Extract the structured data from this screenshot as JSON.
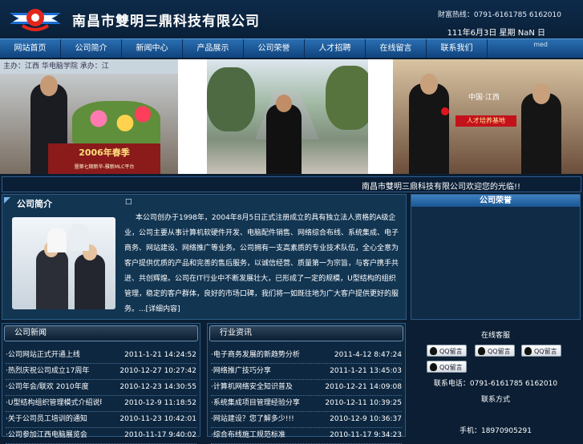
{
  "header": {
    "company_name": "南昌市雙明三鼎科技有限公司",
    "hotline": "财富热线：0791-6161785 6162010",
    "date": "111年6月3日 星期 NaN 日"
  },
  "nav": {
    "items": [
      "网站首页",
      "公司简介",
      "新闻中心",
      "产品展示",
      "公司荣誉",
      "人才招聘",
      "在线留言",
      "联系我们"
    ],
    "tail": "med"
  },
  "banner": {
    "photo1_caption": "2006年春季",
    "photo1_sub": "暨第七期新华-雅新MLC平台",
    "photo1_top": "主办：江西   华电脑学院    承办：江",
    "photo3_caption": "中国·江西",
    "photo3_sub": "人才培养基地"
  },
  "marquee": "南昌市雙明三鼎科技有限公司欢迎您的光临!!",
  "intro": {
    "title": "公司简介",
    "marker": "□",
    "text": "本公司创办于1998年，2004年8月5日正式注册成立的具有独立法人资格的A级企业，公司主要从事计算机软硬件开发、电脑配件销售、网络综合布线、系统集成、电子商务、网站建设、网络推广等业务。公司拥有一支高素质的专业技术队伍，全心全意为客户提供优质的产品和完善的售后服务，以诚信经营、质量第一为宗旨，与客户携手共进、共创辉煌。公司在IT行业中不断发展壮大，已形成了一定的规模，U型结构的组织管理，稳定的客户群体，良好的市场口碑，我们将一如既往地为广大客户提供更好的服务。...[详细内容]"
  },
  "right_panel": {
    "title": "公司荣誉"
  },
  "news_left": {
    "title": "公司新闻",
    "rows": [
      {
        "title": "·公司网站正式开通上线",
        "date": "2011-1-21 14:24:52"
      },
      {
        "title": "·热烈庆祝公司成立17周年",
        "date": "2010-12-27 10:27:42"
      },
      {
        "title": "·公司年会/联欢 2010年度",
        "date": "2010-12-23 14:30:55"
      },
      {
        "title": "·U型结构组织管理模式介绍说明",
        "date": "2010-12-9 11:18:52"
      },
      {
        "title": "·关于公司员工培训的通知",
        "date": "2010-11-23 10:42:01"
      },
      {
        "title": "·公司参加江西电脑展览会",
        "date": "2010-11-17 9:40:02"
      }
    ]
  },
  "news_right": {
    "title": "行业资讯",
    "rows": [
      {
        "title": "·电子商务发展的新趋势分析",
        "date": "2011-4-12 8:47:24"
      },
      {
        "title": "·网络推广技巧分享",
        "date": "2011-1-21 13:45:03"
      },
      {
        "title": "·计算机网络安全知识普及",
        "date": "2010-12-21 14:09:08"
      },
      {
        "title": "·系统集成项目管理经验分享",
        "date": "2010-12-11 10:39:25"
      },
      {
        "title": "·网站建设？您了解多少!!!",
        "date": "2010-12-9 10:36:37"
      },
      {
        "title": "·综合布线施工规范标准",
        "date": "2010-11-17 9:34:23"
      }
    ]
  },
  "contact": {
    "online_title": "在线客服",
    "qq_label": "QQ留言",
    "phone": "联系电话：0791-6161785 6162010",
    "info_title": "联系方式",
    "mobile": "手机：18970905291"
  },
  "colors": {
    "background": "#0b1e33",
    "nav": "#1a5a9a",
    "accent": "#7bb3e6"
  }
}
